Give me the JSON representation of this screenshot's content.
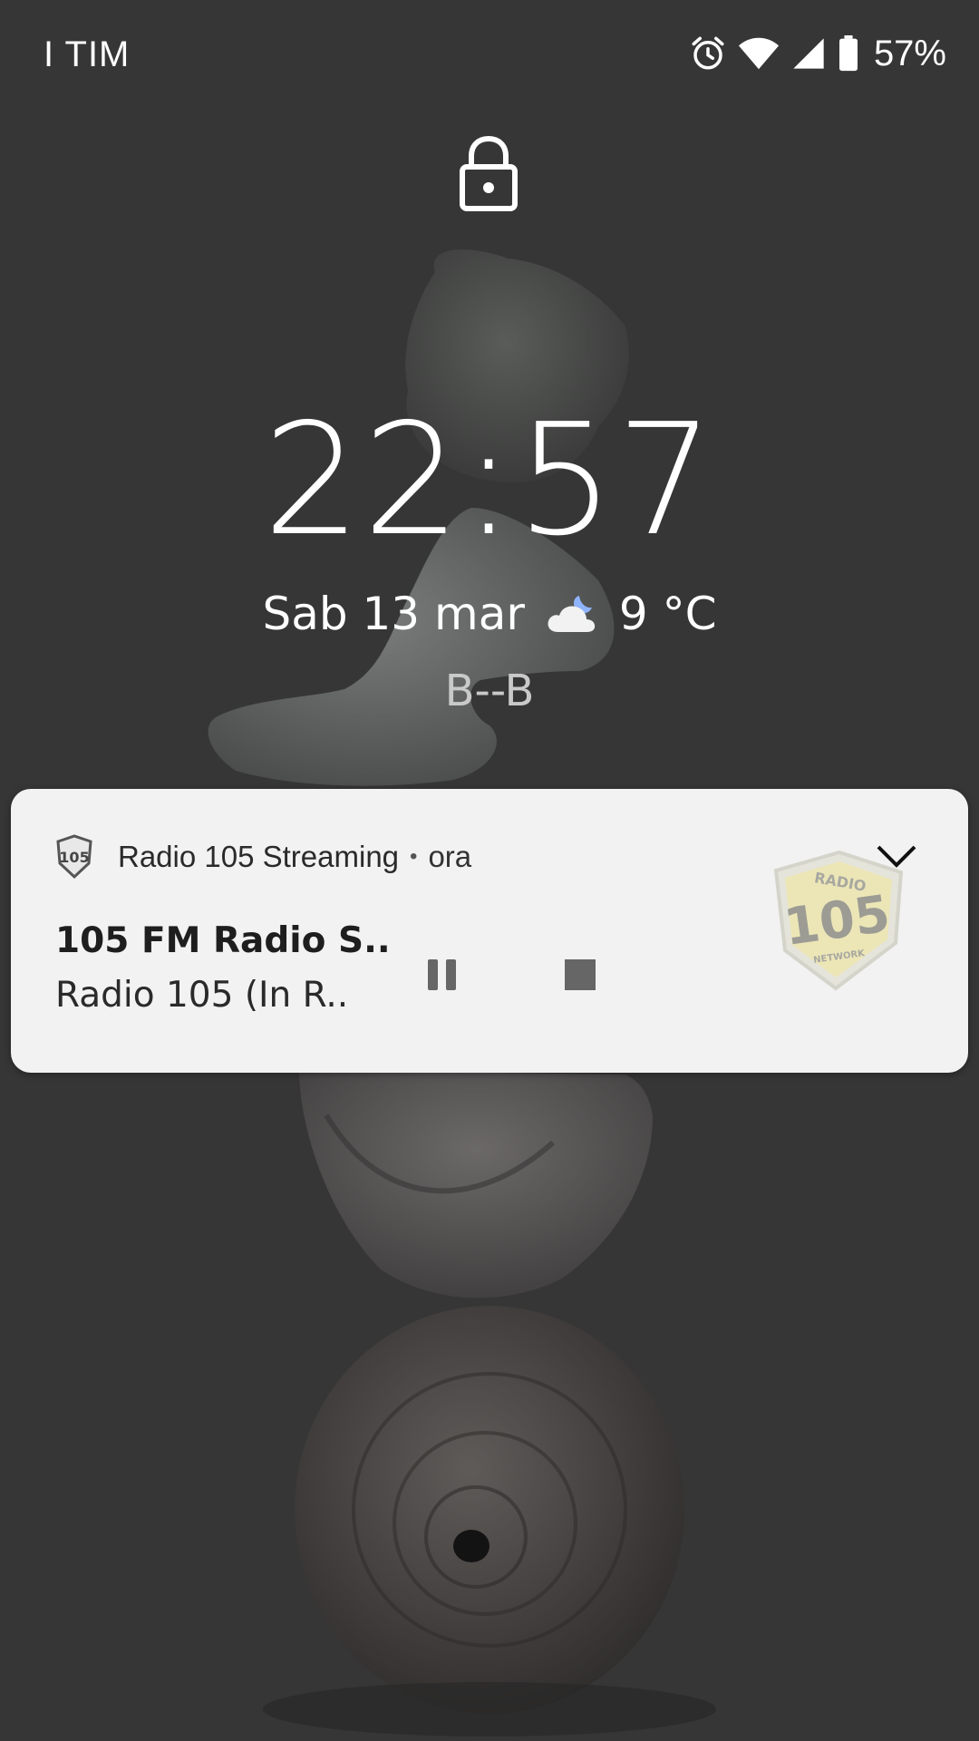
{
  "status_bar": {
    "carrier": "I TIM",
    "battery_percent": "57%",
    "icons": [
      "alarm-icon",
      "wifi-icon",
      "signal-icon",
      "battery-icon"
    ]
  },
  "lockscreen": {
    "lock_icon": "lock-icon",
    "time": "22:57",
    "date": "Sab 13 mar",
    "weather_icon": "partly-cloudy-night-icon",
    "temperature": "9 °C",
    "owner_info": "B--B"
  },
  "notification": {
    "app_icon": "radio-105-logo-icon",
    "app_name": "Radio 105 Streaming",
    "separator": "•",
    "time": "ora",
    "title": "105 FM Radio S..",
    "subtitle": "Radio 105  (In R..",
    "actions": [
      "pause-icon",
      "stop-icon"
    ],
    "expand_icon": "chevron-down-icon",
    "album_art": {
      "line1": "RADIO",
      "line2": "105",
      "line3": "NETWORK"
    },
    "app_icon_text": "105"
  },
  "colors": {
    "background": "#363636",
    "card": "#f2f2f2",
    "text_light": "#ffffff",
    "logo_yellow": "#f0e8a8"
  }
}
